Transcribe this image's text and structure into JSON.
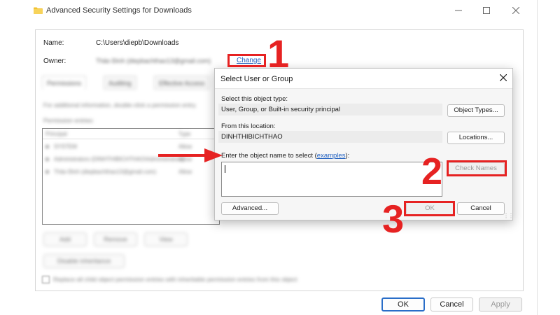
{
  "window": {
    "title": "Advanced Security Settings for Downloads",
    "name_label": "Name:",
    "name_value": "C:\\Users\\diepb\\Downloads",
    "owner_label": "Owner:",
    "owner_value": "Thảo Đinh (diepbachthao13@gmail.com)",
    "change_link": "Change",
    "tabs": [
      "Permissions",
      "Auditing",
      "Effective Access"
    ],
    "info_text": "For additional information, double-click a permission entry.",
    "entries_label": "Permission entries:",
    "list_headers": [
      "Principal",
      "Type"
    ],
    "list_rows": [
      {
        "principal": "SYSTEM",
        "type": "Allow"
      },
      {
        "principal": "Administrators (DINHTHIBICHTHAO\\Administrators)",
        "type": "Allow"
      },
      {
        "principal": "Thảo Đinh (diepbachthao13@gmail.com)",
        "type": "Allow"
      }
    ],
    "add_btn": "Add",
    "remove_btn": "Remove",
    "view_btn": "View",
    "disable_inheritance_btn": "Disable inheritance",
    "replace_checkbox_label": "Replace all child object permission entries with inheritable permission entries from this object",
    "ok_btn": "OK",
    "cancel_btn": "Cancel",
    "apply_btn": "Apply"
  },
  "dialog": {
    "title": "Select User or Group",
    "object_type_label": "Select this object type:",
    "object_type_value": "User, Group, or Built-in security principal",
    "object_types_btn": "Object Types...",
    "location_label": "From this location:",
    "location_value": "DINHTHIBICHTHAO",
    "locations_btn": "Locations...",
    "enter_label_prefix": "Enter the object name to select (",
    "examples_link": "examples",
    "enter_label_suffix": "):",
    "name_input_value": "",
    "check_names_btn": "Check Names",
    "advanced_btn": "Advanced...",
    "ok_btn": "OK",
    "cancel_btn": "Cancel"
  },
  "annotations": {
    "step1": "1",
    "step2": "2",
    "step3": "3",
    "color": "#e62222"
  },
  "icons": {
    "folder": "folder-icon",
    "user": "user-icon",
    "minimize": "minimize-icon",
    "maximize": "maximize-icon",
    "close": "close-icon",
    "arrow": "red-arrow-icon"
  }
}
